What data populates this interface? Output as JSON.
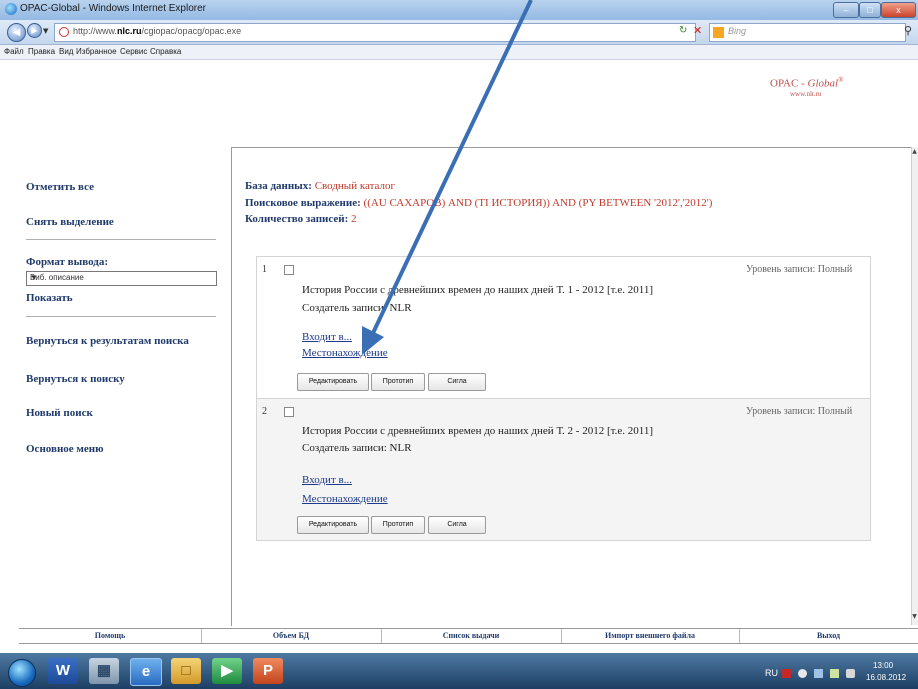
{
  "window": {
    "title": "OPAC-Global - Windows Internet Explorer",
    "minimize": "–",
    "maximize": "□",
    "close": "x"
  },
  "address": {
    "url_prefix": "http://www.",
    "url_domain": "nlc.ru",
    "url_suffix": "/cgiopac/opacg/opac.exe",
    "search_placeholder": "Bing"
  },
  "menu": [
    "Файл",
    "Правка",
    "Вид",
    "Избранное",
    "Сервис",
    "Справка"
  ],
  "brand": {
    "name": "OPAC - ",
    "name_italic": "Global",
    "reg": "®",
    "url": "www.nlr.ru"
  },
  "sidebar": {
    "mark_all": "Отметить все",
    "unmark": "Снять выделение",
    "format_label": "Формат вывода:",
    "format_value": "Биб. описание",
    "show": "Показать",
    "back_results": "Вернуться к результатам поиска",
    "back_search": "Вернуться к поиску",
    "new_search": "Новый поиск",
    "main_menu": "Основное меню"
  },
  "info": {
    "db_label": "База данных: ",
    "db_value": "Сводный каталог",
    "query_label": "Поисковое выражение: ",
    "query_value": "((AU САХАРОВ) AND (TI ИСТОРИЯ)) AND (PY BETWEEN '2012','2012')",
    "count_label": "Количество записей: ",
    "count_value": "2"
  },
  "records": [
    {
      "num": "1",
      "level": "Уровень записи: Полный",
      "title": "История России с древнейших времен до наших дней Т. 1 - 2012 [т.е. 2011]",
      "creator": "Создатель записи: NLR",
      "link_in": "Входит в...",
      "link_loc": "Местонахождение",
      "btn_edit": "Редактировать",
      "btn_proto": "Прототип",
      "btn_sigla": "Сигла"
    },
    {
      "num": "2",
      "level": "Уровень записи: Полный",
      "title": "История России с древнейших времен до наших дней Т. 2 - 2012 [т.е. 2011]",
      "creator": "Создатель записи: NLR",
      "link_in": "Входит в...",
      "link_loc": "Местонахождение",
      "btn_edit": "Редактировать",
      "btn_proto": "Прототип",
      "btn_sigla": "Сигла"
    }
  ],
  "bottom_nav": [
    "Помощь",
    "Объем БД",
    "Список выдачи",
    "Импорт внешнего файла",
    "Выход"
  ],
  "taskbar": {
    "lang": "RU",
    "time": "13:00",
    "date": "16.08.2012",
    "apps": [
      "word-icon",
      "calculator-icon",
      "ie-icon",
      "explorer-icon",
      "media-icon",
      "powerpoint-icon"
    ]
  },
  "colors": {
    "link": "#1f3a6b",
    "accent_red": "#c0392b",
    "arrow": "#3a6fb5"
  }
}
